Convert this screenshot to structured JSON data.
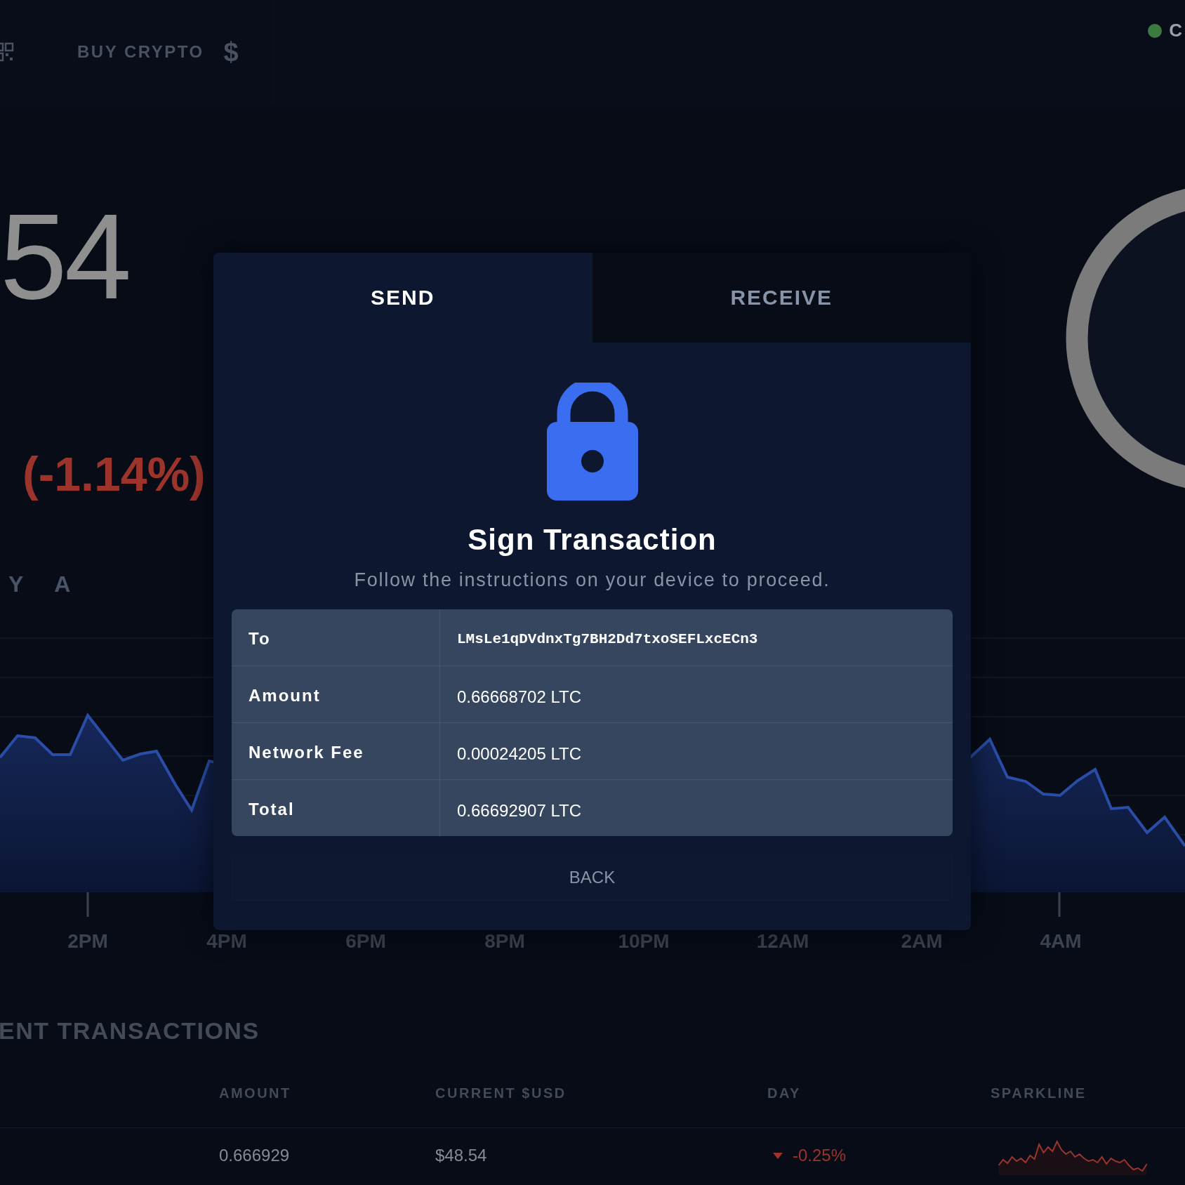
{
  "top_bar": {
    "nav_label": "BUY CRYPTO",
    "currency_symbol": "$",
    "status_label": "C"
  },
  "price": {
    "value": "54",
    "change": "(-1.14%)"
  },
  "periods": [
    "Y",
    "A"
  ],
  "time_labels": [
    "2PM",
    "4PM",
    "6PM",
    "8PM",
    "10PM",
    "12AM",
    "2AM",
    "4AM"
  ],
  "recent": {
    "title": "ENT TRANSACTIONS",
    "columns": [
      "AMOUNT",
      "CURRENT $USD",
      "DAY",
      "SPARKLINE"
    ],
    "rows": [
      {
        "amount": "0.666929",
        "usd": "$48.54",
        "day": "-0.25%",
        "down": true
      }
    ]
  },
  "modal": {
    "tabs": [
      {
        "label": "SEND",
        "selected": true
      },
      {
        "label": "RECEIVE",
        "selected": false
      }
    ],
    "title": "Sign Transaction",
    "subtitle": "Follow the instructions on your device to proceed.",
    "details": [
      {
        "label": "To",
        "value": "LMsLe1qDVdnxTg7BH2Dd7txoSEFLxcECn3",
        "kind": "address"
      },
      {
        "label": "Amount",
        "value": "0.66668702 LTC",
        "kind": "amount"
      },
      {
        "label": "Network Fee",
        "value": "0.00024205 LTC",
        "kind": "amount"
      },
      {
        "label": "Total",
        "value": "0.66692907 LTC",
        "kind": "amount"
      }
    ],
    "back_button": "BACK"
  }
}
